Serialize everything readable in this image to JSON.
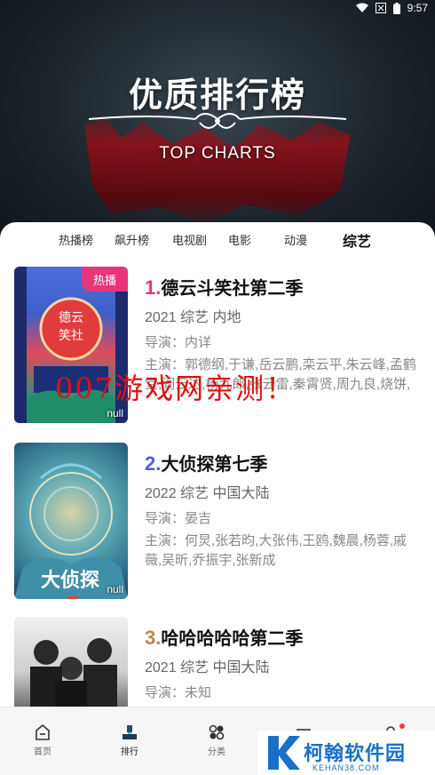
{
  "status_bar": {
    "time": "9:57"
  },
  "hero": {
    "title": "优质排行榜",
    "subtitle": "TOP CHARTS"
  },
  "tabs": [
    {
      "label": "热播榜"
    },
    {
      "label": "飙升榜"
    },
    {
      "label": "电视剧"
    },
    {
      "label": "电影"
    },
    {
      "label": "动漫"
    },
    {
      "label": "综艺",
      "active": true
    }
  ],
  "items": [
    {
      "rank": "1.",
      "title": "德云斗笑社第二季",
      "meta": "2021  综艺  内地",
      "director": "导演：内详",
      "cast": "主演：郭德纲,于谦,岳云鹏,栾云平,朱云峰,孟鹤堂,阎云达,杨九郎,张云雷,秦霄贤,周九良,烧饼,曹鹤阳,尚九熙,何九华,孙越,郭麒麟,张鹤伦",
      "badge": "热播",
      "poster_label": "null",
      "rank_color": "#e8357a"
    },
    {
      "rank": "2.",
      "title": "大侦探第七季",
      "meta": "2022  综艺  中国大陆",
      "director": "导演：晏吉",
      "cast": "主演：何炅,张若昀,大张伟,王鸥,魏晨,杨蓉,戚薇,吴昕,乔振宇,张新成",
      "poster_label": "null",
      "rank_color": "#5a5ad6"
    },
    {
      "rank": "3.",
      "title": "哈哈哈哈哈第二季",
      "meta": "2021  综艺  中国大陆",
      "director": "导演：未知",
      "rank_color": "#b8865a"
    }
  ],
  "watermark": "007游戏网亲测！",
  "bottom_nav": [
    {
      "label": "首页",
      "icon": "home-icon"
    },
    {
      "label": "排行",
      "icon": "ranking-icon",
      "active": true
    },
    {
      "label": "分类",
      "icon": "category-icon"
    },
    {
      "label": "",
      "icon": "gift-icon"
    },
    {
      "label": "",
      "icon": "profile-icon"
    }
  ],
  "site_badge": {
    "name": "柯翰软件园",
    "url": "KEHAN38.COM"
  }
}
